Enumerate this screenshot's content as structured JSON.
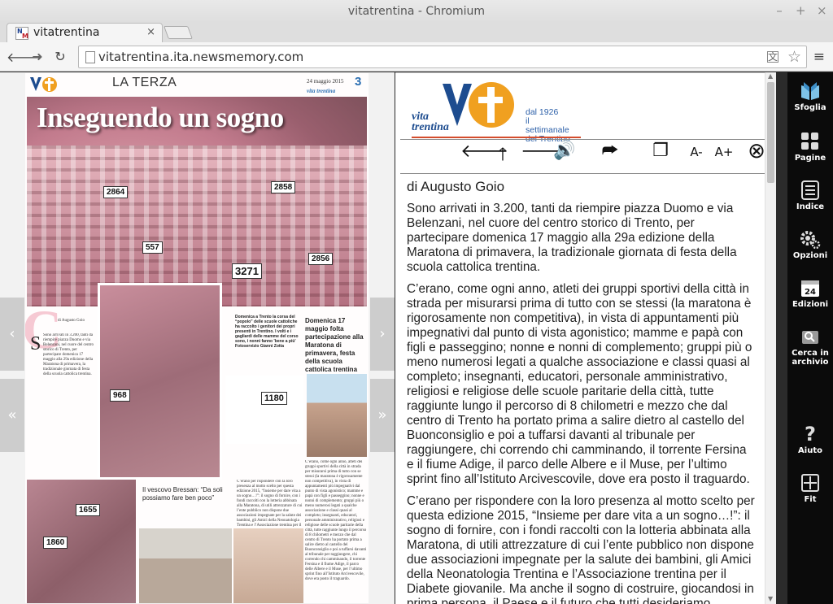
{
  "browser": {
    "window_title": "vitatrentina - Chromium",
    "tab_title": "vitatrentina",
    "tab_close": "×",
    "url": "vitatrentina.ita.newsmemory.com",
    "back": "🡐",
    "forward": "➜",
    "reload": "↻",
    "win_minimize": "–",
    "win_maximize": "+",
    "win_close": "×"
  },
  "page_thumb": {
    "section": "LA TERZA",
    "date": "24 maggio 2015",
    "page_number": "3",
    "brand": "vita trentina",
    "headline": "Inseguendo un sogno",
    "byline": "di Augusto Goio",
    "caption_a": "Domenica a Trento la corsa del “popolo” delle scuole cattoliche ha raccolto i genitori dei propri presenti in Trentino. I volti e i gagliardi delle mamme del corso sono, i nonni fanno 'bene a più'",
    "caption_a2": "Fotoservizio Gianni Zotta",
    "caption_b": "Domenica 17 maggio folta partecipazione alla Maratona di primavera, festa della scuola cattolica trentina",
    "subhead_b": "Il vescovo Bressan: “Da soli possiamo fare ben poco”",
    "bibs": [
      "2864",
      "2858",
      "557",
      "3271",
      "2856",
      "968",
      "1180",
      "1655",
      "1860"
    ]
  },
  "nav": {
    "prev": "‹",
    "next": "›",
    "first": "«",
    "last": "»"
  },
  "reader": {
    "logo_name_1": "vita",
    "logo_name_2": "trentina",
    "logo_tag_1": "dal 1926",
    "logo_tag_2": "il settimanale",
    "logo_tag_3": "del Trentino",
    "controls": {
      "prev": "🡐",
      "up": "🡑",
      "next": "🡒",
      "audio": "🔊",
      "share": "⮫",
      "copy": "❐",
      "font_smaller": "A-",
      "font_larger": "A+",
      "close": "⊗"
    },
    "byline": "di Augusto Goio",
    "paragraphs": [
      "Sono arrivati in 3.200, tanti da riempire piazza Duomo e via Belenzani, nel cuore del centro storico di Trento, per partecipare domenica 17 maggio alla 29a edizione della Maratona di primavera, la tradizionale giornata di festa della scuola cattolica trentina.",
      "C’erano, come ogni anno, atleti dei gruppi sportivi della città in strada per misurarsi prima di tutto con se stessi (la maratona è rigorosamente non competitiva), in vista di appuntamenti più impegnativi dal punto di vista agonistico; mamme e papà con figli e passeggino; nonne e nonni di complemento; gruppi più o meno numerosi legati a qualche associazione e classi quasi al completo; insegnanti, educatori, personale amministrativo, religiosi e religiose delle scuole paritarie della città, tutte raggiunte lungo il percorso di 8 chilometri e mezzo che dal centro di Trento ha portato prima a salire dietro al castello del Buonconsiglio e poi a tuffarsi davanti al tribunale per raggiungere, chi correndo chi camminando, il torrente Fersina e il fiume Adige, il parco delle Albere e il Muse, per l’ultimo sprint fino all’Istituto Arcivescovile, dove era posto il traguardo.",
      "C’erano per rispondere con la loro presenza al motto scelto per questa edizione 2015, “Insieme per dare vita a un sogno…!”: il sogno di fornire, con i fondi raccolti con la lotteria abbinata alla Maratona, di utili attrezzature di cui l’ente pubblico non dispone due associazioni impegnate per la salute dei bambini, gli Amici della Neonatologia Trentina e l’Associazione trentina per il Diabete giovanile. Ma anche il sogno di costruire, giocandosi in prima persona, il Paese e il futuro che tutti desideriamo."
    ]
  },
  "sidebar": {
    "items": [
      {
        "label": "Sfoglia",
        "icon": "book-icon"
      },
      {
        "label": "Pagine",
        "icon": "grid-icon"
      },
      {
        "label": "Indice",
        "icon": "list-icon"
      },
      {
        "label": "Opzioni",
        "icon": "gear-icon"
      },
      {
        "label": "Edizioni",
        "icon": "calendar-icon"
      },
      {
        "label": "Cerca in archivio",
        "icon": "search-archive-icon"
      },
      {
        "label": "Aiuto",
        "icon": "help-icon"
      },
      {
        "label": "Fit",
        "icon": "fit-icon"
      }
    ],
    "calendar_day": "24",
    "help_glyph": "?"
  },
  "colors": {
    "brand_blue": "#1d4c8f",
    "brand_orange": "#f0a020",
    "accent_red": "#d44d2c",
    "sidebar_bg": "#0b0b0b"
  }
}
